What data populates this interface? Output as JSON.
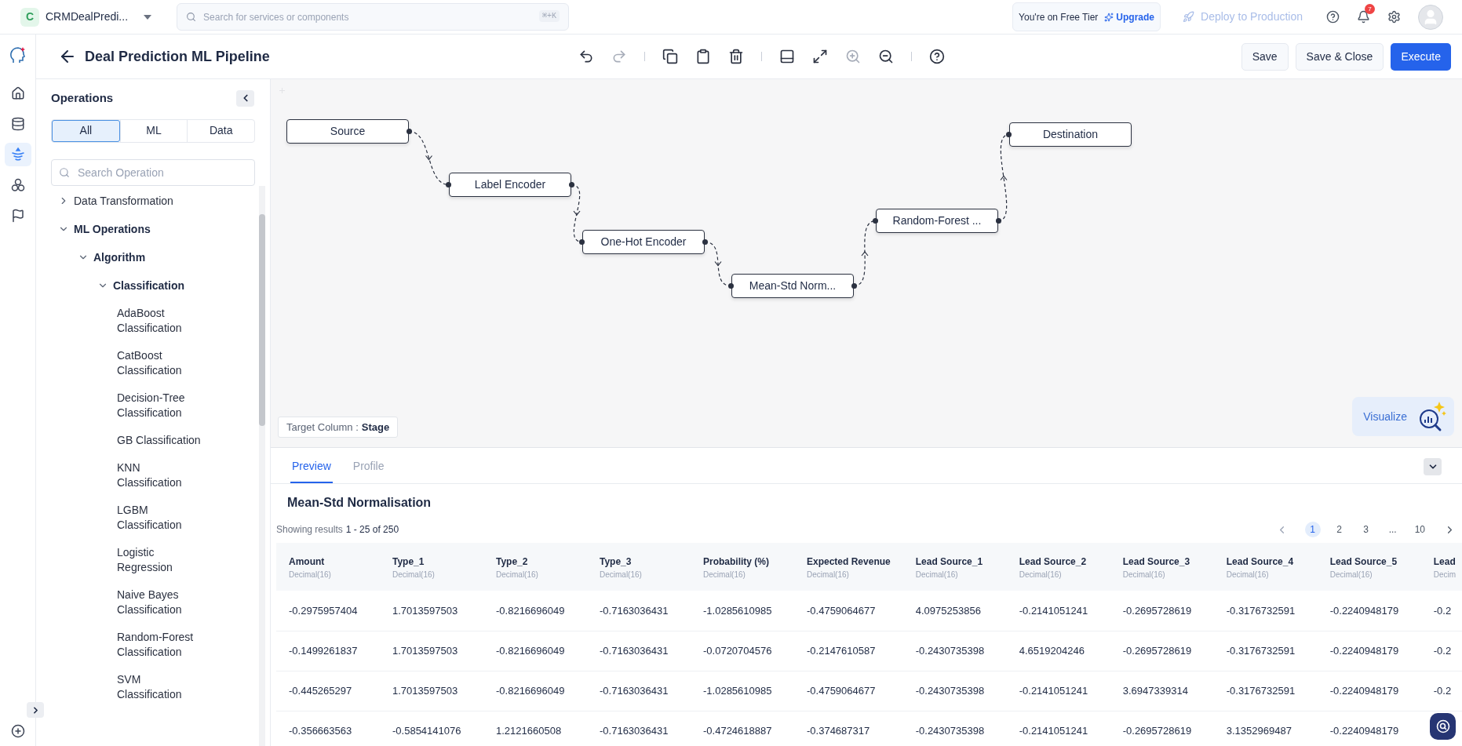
{
  "top_bar": {
    "app": {
      "initial": "C",
      "name": "CRMDealPredi..."
    },
    "search": {
      "placeholder": "Search for services or components",
      "shortcut": "⌘+K"
    },
    "tier": {
      "text": "You're on Free Tier",
      "upgrade": "Upgrade"
    },
    "deploy": {
      "label": "Deploy to Production",
      "disabled": true
    },
    "notifications": {
      "count": "7"
    }
  },
  "rail": [
    {
      "kind": "home",
      "selected": false
    },
    {
      "kind": "database",
      "selected": false
    },
    {
      "kind": "pipeline",
      "selected": true
    },
    {
      "kind": "models",
      "selected": false
    },
    {
      "kind": "flag",
      "selected": false
    }
  ],
  "header": {
    "title": "Deal Prediction ML Pipeline",
    "toolbar": [
      {
        "kind": "undo",
        "disabled": false
      },
      {
        "kind": "redo",
        "disabled": true
      },
      {
        "kind": "separator"
      },
      {
        "kind": "copy",
        "disabled": false
      },
      {
        "kind": "paste",
        "disabled": false
      },
      {
        "kind": "delete",
        "disabled": false
      },
      {
        "kind": "separator"
      },
      {
        "kind": "panel",
        "disabled": false
      },
      {
        "kind": "expand",
        "disabled": false
      },
      {
        "kind": "zoom-in",
        "disabled": true
      },
      {
        "kind": "zoom-out",
        "disabled": false
      },
      {
        "kind": "separator"
      },
      {
        "kind": "help",
        "disabled": false
      }
    ],
    "buttons": [
      {
        "label": "Save",
        "kind": "secondary"
      },
      {
        "label": "Save & Close",
        "kind": "secondary"
      },
      {
        "label": "Execute",
        "kind": "primary"
      }
    ]
  },
  "sidebar": {
    "title": "Operations",
    "filters": [
      {
        "label": "All",
        "selected": true
      },
      {
        "label": "ML",
        "selected": false
      },
      {
        "label": "Data",
        "selected": false
      }
    ],
    "search": {
      "placeholder": "Search Operation"
    },
    "tree": [
      {
        "label": "Data Transformation",
        "expanded": false
      },
      {
        "label": "ML Operations",
        "expanded": true,
        "children": [
          {
            "label": "Algorithm",
            "expanded": true,
            "children": [
              {
                "label": "Classification",
                "expanded": true,
                "children": [
                  {
                    "label": "AdaBoost Classification"
                  },
                  {
                    "label": "CatBoost Classification"
                  },
                  {
                    "label": "Decision-Tree Classification"
                  },
                  {
                    "label": "GB Classification"
                  },
                  {
                    "label": "KNN Classification"
                  },
                  {
                    "label": "LGBM Classification"
                  },
                  {
                    "label": "Logistic Regression"
                  },
                  {
                    "label": "Naive Bayes Classification"
                  },
                  {
                    "label": "Random-Forest Classification"
                  },
                  {
                    "label": "SVM Classification"
                  }
                ]
              }
            ]
          }
        ]
      }
    ]
  },
  "canvas": {
    "nodes": [
      {
        "label": "Source"
      },
      {
        "label": "Label Encoder"
      },
      {
        "label": "One-Hot Encoder"
      },
      {
        "label": "Mean-Std Norm..."
      },
      {
        "label": "Random-Forest ..."
      },
      {
        "label": "Destination"
      }
    ],
    "target_column": {
      "label": "Target Column :",
      "value": "Stage"
    },
    "visualize": "Visualize"
  },
  "preview": {
    "tabs": [
      {
        "label": "Preview",
        "selected": true
      },
      {
        "label": "Profile",
        "selected": false
      }
    ],
    "title": "Mean-Std Normalisation",
    "results": {
      "label": "Showing results",
      "range": "1 - 25 of 250"
    },
    "pagination": [
      {
        "label": "1",
        "selected": true
      },
      {
        "label": "2",
        "selected": false
      },
      {
        "label": "3",
        "selected": false
      },
      {
        "label": "...",
        "selected": false
      },
      {
        "label": "10",
        "selected": false
      }
    ],
    "table": {
      "columns": [
        {
          "name": "Amount",
          "type": "Decimal(16)"
        },
        {
          "name": "Type_1",
          "type": "Decimal(16)"
        },
        {
          "name": "Type_2",
          "type": "Decimal(16)"
        },
        {
          "name": "Type_3",
          "type": "Decimal(16)"
        },
        {
          "name": "Probability (%)",
          "type": "Decimal(16)"
        },
        {
          "name": "Expected Revenue",
          "type": "Decimal(16)"
        },
        {
          "name": "Lead Source_1",
          "type": "Decimal(16)"
        },
        {
          "name": "Lead Source_2",
          "type": "Decimal(16)"
        },
        {
          "name": "Lead Source_3",
          "type": "Decimal(16)"
        },
        {
          "name": "Lead Source_4",
          "type": "Decimal(16)"
        },
        {
          "name": "Lead Source_5",
          "type": "Decimal(16)"
        },
        {
          "name": "Lead",
          "type": "Decim"
        }
      ],
      "rows": [
        [
          "-0.2975957404",
          "1.7013597503",
          "-0.8216696049",
          "-0.7163036431",
          "-1.0285610985",
          "-0.4759064677",
          "4.0975253856",
          "-0.2141051241",
          "-0.2695728619",
          "-0.3176732591",
          "-0.2240948179",
          "-0.2"
        ],
        [
          "-0.1499261837",
          "1.7013597503",
          "-0.8216696049",
          "-0.7163036431",
          "-0.0720704576",
          "-0.2147610587",
          "-0.2430735398",
          "4.6519204246",
          "-0.2695728619",
          "-0.3176732591",
          "-0.2240948179",
          "-0.2"
        ],
        [
          "-0.445265297",
          "1.7013597503",
          "-0.8216696049",
          "-0.7163036431",
          "-1.0285610985",
          "-0.4759064677",
          "-0.2430735398",
          "-0.2141051241",
          "3.6947339314",
          "-0.3176732591",
          "-0.2240948179",
          "-0.2"
        ],
        [
          "-0.356663563",
          "-0.5854141076",
          "1.2121660508",
          "-0.7163036431",
          "-0.4724618887",
          "-0.374687317",
          "-0.2430735398",
          "-0.2141051241",
          "-0.2695728619",
          "3.1352969487",
          "-0.2240948179"
        ]
      ]
    }
  }
}
